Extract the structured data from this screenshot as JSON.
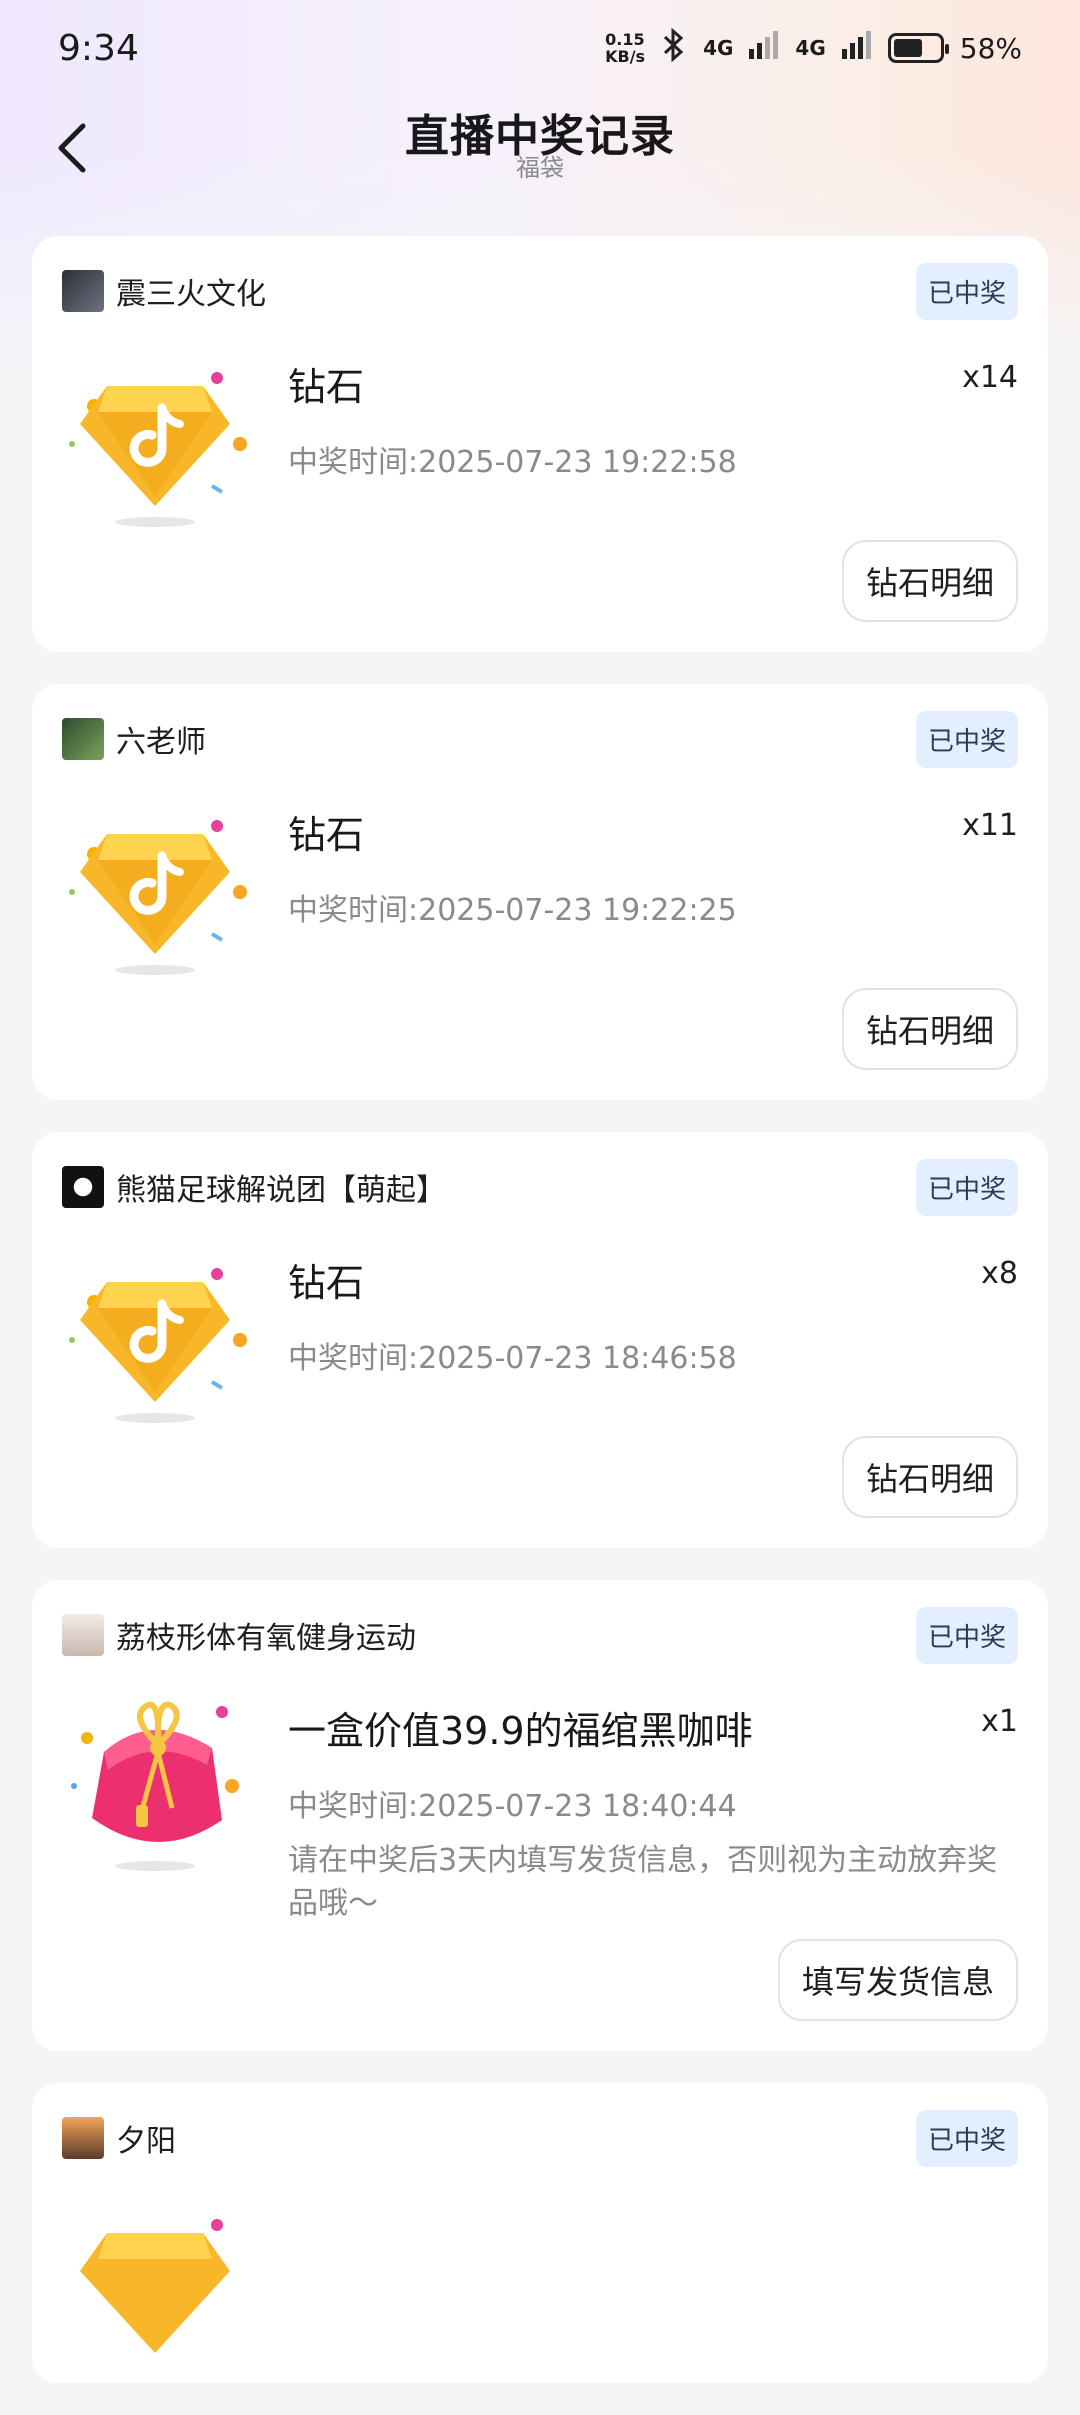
{
  "status_bar": {
    "time": "9:34",
    "net_speed_value": "0.15",
    "net_speed_unit": "KB/s",
    "signal1": "4G",
    "signal2": "4G",
    "battery": "58%"
  },
  "header": {
    "title": "直播中奖记录",
    "subtitle": "福袋"
  },
  "records": [
    {
      "streamer": "震三火文化",
      "status": "已中奖",
      "prize": "钻石",
      "quantity": "x14",
      "time": "中奖时间:2025-07-23 19:22:58",
      "action": "钻石明细",
      "icon": "diamond-icon"
    },
    {
      "streamer": "六老师",
      "status": "已中奖",
      "prize": "钻石",
      "quantity": "x11",
      "time": "中奖时间:2025-07-23 19:22:25",
      "action": "钻石明细",
      "icon": "diamond-icon"
    },
    {
      "streamer": "熊猫足球解说团【萌起】",
      "status": "已中奖",
      "prize": "钻石",
      "quantity": "x8",
      "time": "中奖时间:2025-07-23 18:46:58",
      "action": "钻石明细",
      "icon": "diamond-icon"
    },
    {
      "streamer": "荔枝形体有氧健身运动",
      "status": "已中奖",
      "prize": "一盒价值39.9的福绾黑咖啡",
      "quantity": "x1",
      "time": "中奖时间:2025-07-23 18:40:44",
      "note": "请在中奖后3天内填写发货信息，否则视为主动放弃奖品哦～",
      "action": "填写发货信息",
      "icon": "lucky-bag-icon"
    },
    {
      "streamer": "夕阳",
      "status": "已中奖",
      "icon": "diamond-icon"
    }
  ]
}
